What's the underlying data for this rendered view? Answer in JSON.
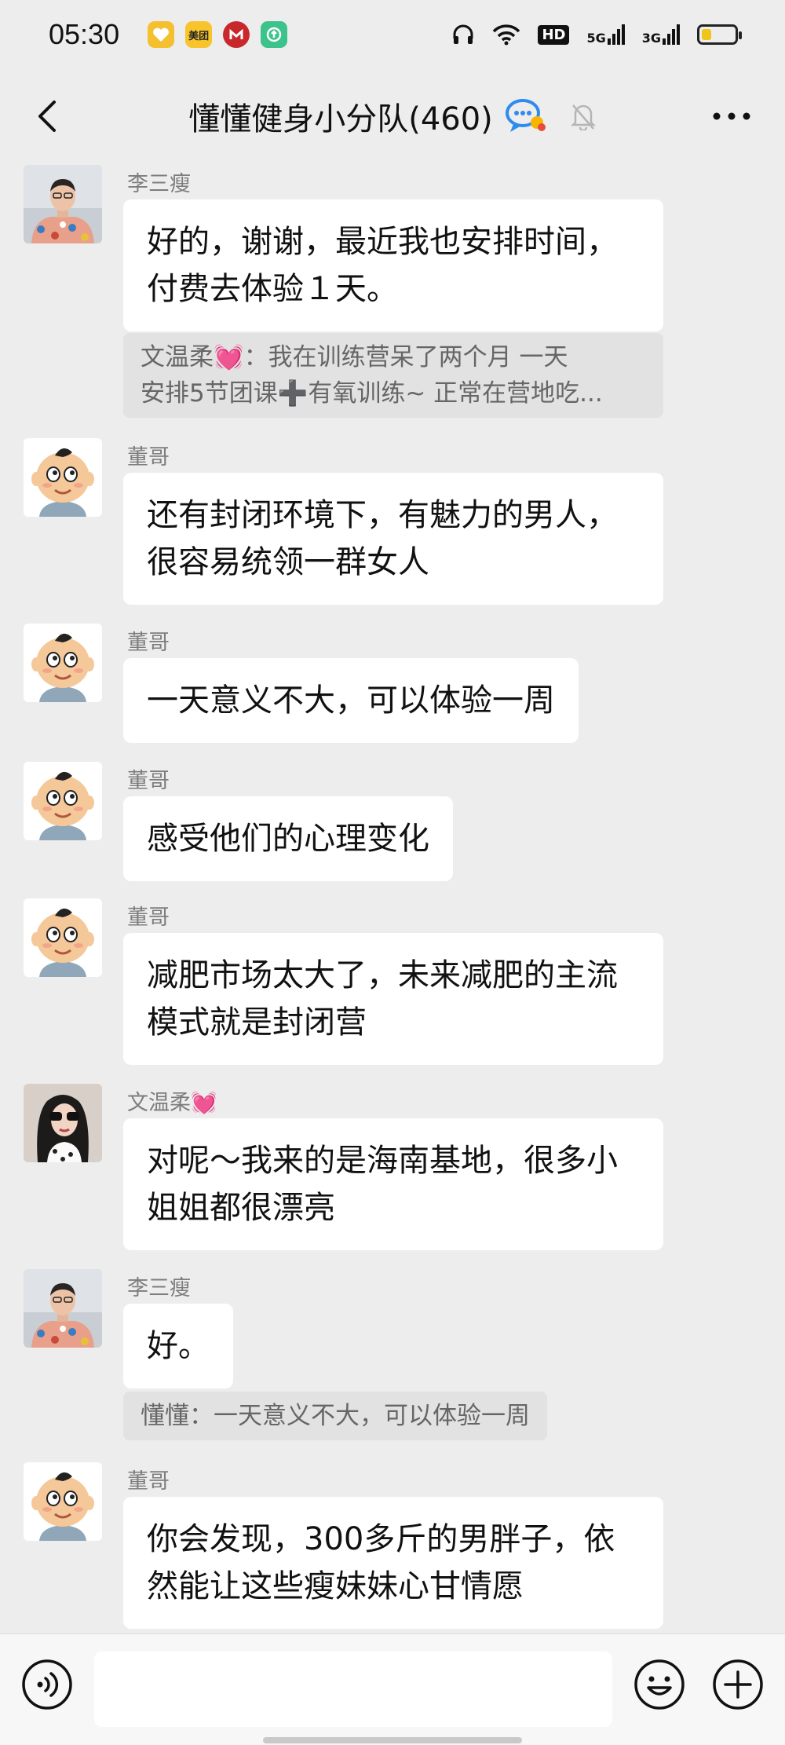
{
  "status_bar": {
    "time": "05:30",
    "apps": [
      {
        "name": "heart-app-icon",
        "color": "#f5c030",
        "label": ""
      },
      {
        "name": "meituan-app-icon",
        "color": "#f7c52b",
        "label": "美团"
      },
      {
        "name": "bank-app-icon",
        "color": "#c8282b",
        "label": ""
      },
      {
        "name": "green-app-icon",
        "color": "#3cc28b",
        "label": ""
      }
    ],
    "hd_label": "HD",
    "net_5g": "5G",
    "net_3g": "3G",
    "battery_fraction": 0.3
  },
  "header": {
    "title": "懂懂健身小分队(460)"
  },
  "messages": [
    {
      "sender": "李三瘦",
      "avatar": "photo-man",
      "lines": [
        "好的，谢谢，最近我也安排时间，",
        "付费去体验１天。"
      ]
    },
    {
      "quote_lines": [
        "文温柔💓：我在训练营呆了两个月  一天",
        "安排5节团课➕有氧训练~ 正常在营地吃..."
      ]
    },
    {
      "sender": "董哥",
      "avatar": "cartoon-boy",
      "lines": [
        "还有封闭环境下，有魅力的男人，",
        "很容易统领一群女人"
      ]
    },
    {
      "sender": "董哥",
      "avatar": "cartoon-boy",
      "lines": [
        "一天意义不大，可以体验一周"
      ]
    },
    {
      "sender": "董哥",
      "avatar": "cartoon-boy",
      "lines": [
        "感受他们的心理变化"
      ]
    },
    {
      "sender": "董哥",
      "avatar": "cartoon-boy",
      "lines": [
        "减肥市场太大了，未来减肥的主流",
        "模式就是封闭营"
      ]
    },
    {
      "sender": "文温柔💓",
      "avatar": "photo-woman",
      "lines": [
        "对呢～我来的是海南基地，很多小",
        "姐姐都很漂亮"
      ]
    },
    {
      "sender": "李三瘦",
      "avatar": "photo-man",
      "lines": [
        "好。"
      ]
    },
    {
      "quote_lines": [
        "懂懂：一天意义不大，可以体验一周"
      ]
    },
    {
      "sender": "董哥",
      "avatar": "cartoon-boy",
      "lines": [
        "你会发现，300多斤的男胖子，依",
        "然能让这些瘦妹妹心甘情愿"
      ]
    }
  ],
  "colors": {
    "background": "#ededed",
    "bubble": "#ffffff",
    "quote": "#e2e2e2",
    "muted_text": "#7d7d7d"
  }
}
